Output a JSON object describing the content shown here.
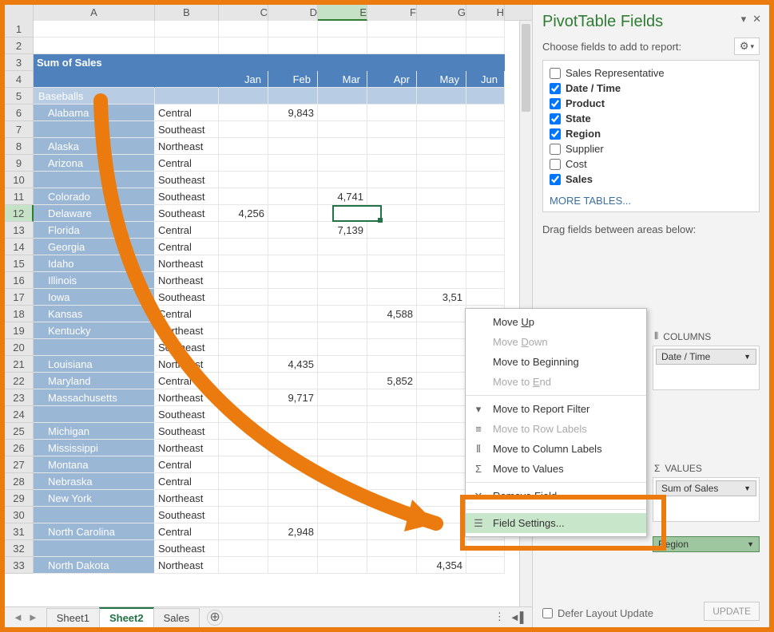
{
  "pivot_title": "PivotTable Fields",
  "pivot_subtitle": "Choose fields to add to report:",
  "more_tables": "MORE TABLES...",
  "drag_label": "Drag fields between areas below:",
  "defer_label": "Defer Layout Update",
  "update_label": "UPDATE",
  "columns": [
    "A",
    "B",
    "C",
    "D",
    "E",
    "F",
    "G",
    "H"
  ],
  "month_headers": [
    "Jan",
    "Feb",
    "Mar",
    "Apr",
    "May",
    "Jun"
  ],
  "sum_label": "Sum of Sales",
  "group_label": "Baseballs",
  "fields": [
    {
      "label": "Sales Representative",
      "checked": false
    },
    {
      "label": "Date / Time",
      "checked": true
    },
    {
      "label": "Product",
      "checked": true
    },
    {
      "label": "State",
      "checked": true
    },
    {
      "label": "Region",
      "checked": true
    },
    {
      "label": "Supplier",
      "checked": false
    },
    {
      "label": "Cost",
      "checked": false
    },
    {
      "label": "Sales",
      "checked": true
    }
  ],
  "areas": {
    "columns": {
      "title": "COLUMNS",
      "items": [
        "Date / Time"
      ]
    },
    "values": {
      "title": "VALUES",
      "items": [
        "Sum of Sales"
      ]
    },
    "rows_region": "Region"
  },
  "context_menu": [
    {
      "label": "Move Up",
      "under": "U",
      "disabled": false
    },
    {
      "label": "Move Down",
      "under": "D",
      "disabled": true
    },
    {
      "label": "Move to Beginning",
      "under": "g",
      "disabled": false
    },
    {
      "label": "Move to End",
      "under": "E",
      "disabled": true
    },
    {
      "label": "Move to Report Filter",
      "icon": "▾",
      "disabled": false
    },
    {
      "label": "Move to Row Labels",
      "icon": "≡",
      "disabled": true
    },
    {
      "label": "Move to Column Labels",
      "icon": "⦀",
      "disabled": false
    },
    {
      "label": "Move to Values",
      "icon": "Σ",
      "disabled": false
    },
    {
      "label": "Remove Field",
      "icon": "✕",
      "disabled": false
    },
    {
      "label": "Field Settings...",
      "icon": "☰",
      "disabled": false,
      "hover": true
    }
  ],
  "sheets": [
    "Sheet1",
    "Sheet2",
    "Sales"
  ],
  "active_sheet": "Sheet2",
  "rows": [
    {
      "n": 1,
      "a": "",
      "b": ""
    },
    {
      "n": 2,
      "a": "",
      "b": ""
    },
    {
      "n": 3,
      "a": "Sum of Sales",
      "hdr": true
    },
    {
      "n": 4,
      "months": true
    },
    {
      "n": 5,
      "a": "Baseballs",
      "group": true
    },
    {
      "n": 6,
      "a": "Alabama",
      "b": "Central",
      "d": "9,843"
    },
    {
      "n": 7,
      "a": "",
      "b": "Southeast"
    },
    {
      "n": 8,
      "a": "Alaska",
      "b": "Northeast"
    },
    {
      "n": 9,
      "a": "Arizona",
      "b": "Central"
    },
    {
      "n": 10,
      "a": "",
      "b": "Southeast"
    },
    {
      "n": 11,
      "a": "Colorado",
      "b": "Southeast",
      "e": "4,741"
    },
    {
      "n": 12,
      "a": "Delaware",
      "b": "Southeast",
      "c": "4,256",
      "sel": true
    },
    {
      "n": 13,
      "a": "Florida",
      "b": "Central",
      "e": "7,139"
    },
    {
      "n": 14,
      "a": "Georgia",
      "b": "Central"
    },
    {
      "n": 15,
      "a": "Idaho",
      "b": "Northeast"
    },
    {
      "n": 16,
      "a": "Illinois",
      "b": "Northeast"
    },
    {
      "n": 17,
      "a": "Iowa",
      "b": "Southeast",
      "g": "3,51"
    },
    {
      "n": 18,
      "a": "Kansas",
      "b": "Central",
      "f": "4,588"
    },
    {
      "n": 19,
      "a": "Kentucky",
      "b": "Northeast"
    },
    {
      "n": 20,
      "a": "",
      "b": "Southeast"
    },
    {
      "n": 21,
      "a": "Louisiana",
      "b": "Northeast",
      "d": "4,435"
    },
    {
      "n": 22,
      "a": "Maryland",
      "b": "Central",
      "f": "5,852"
    },
    {
      "n": 23,
      "a": "Massachusetts",
      "b": "Northeast",
      "d": "9,717"
    },
    {
      "n": 24,
      "a": "",
      "b": "Southeast"
    },
    {
      "n": 25,
      "a": "Michigan",
      "b": "Southeast"
    },
    {
      "n": 26,
      "a": "Mississippi",
      "b": "Northeast"
    },
    {
      "n": 27,
      "a": "Montana",
      "b": "Central"
    },
    {
      "n": 28,
      "a": "Nebraska",
      "b": "Central"
    },
    {
      "n": 29,
      "a": "New York",
      "b": "Northeast"
    },
    {
      "n": 30,
      "a": "",
      "b": "Southeast"
    },
    {
      "n": 31,
      "a": "North Carolina",
      "b": "Central",
      "d": "2,948"
    },
    {
      "n": 32,
      "a": "",
      "b": "Southeast"
    },
    {
      "n": 33,
      "a": "North Dakota",
      "b": "Northeast",
      "g": "4,354"
    }
  ]
}
